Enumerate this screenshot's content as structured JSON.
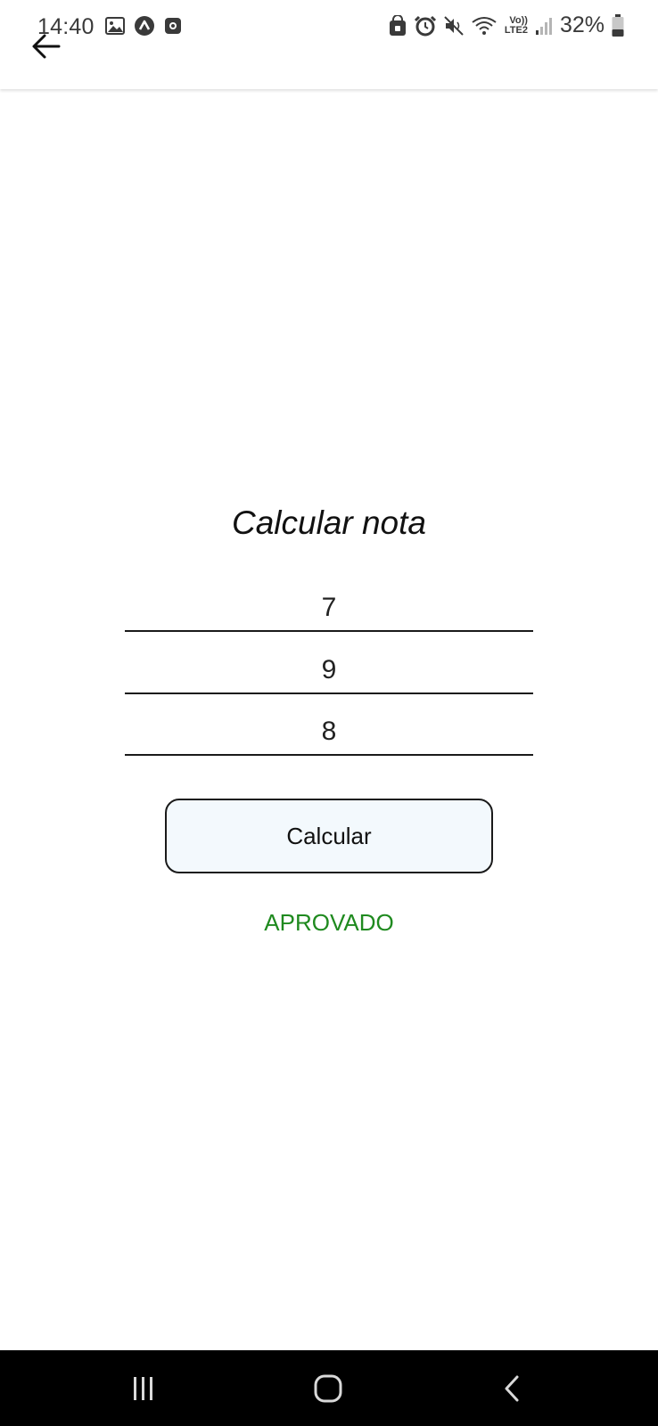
{
  "status_bar": {
    "time": "14:40",
    "battery_percent": "32%",
    "network_label": "LTE2",
    "volte_label": "Vo))",
    "left_icons": [
      "image-icon",
      "app-a-icon",
      "record-icon"
    ],
    "right_icons": [
      "lock-icon",
      "alarm-icon",
      "mute-icon",
      "wifi-icon",
      "signal-icon",
      "battery-icon"
    ]
  },
  "app_bar": {
    "back_icon": "arrow-left-icon"
  },
  "main": {
    "title": "Calcular nota",
    "fields": [
      {
        "value": "7"
      },
      {
        "value": "9"
      },
      {
        "value": "8"
      }
    ],
    "button_label": "Calcular",
    "result": "APROVADO",
    "result_color": "#1f8a1f",
    "button_bg": "#f3f9fd"
  },
  "nav_bar": {
    "items": [
      "recent-apps-icon",
      "home-icon",
      "back-icon"
    ]
  }
}
